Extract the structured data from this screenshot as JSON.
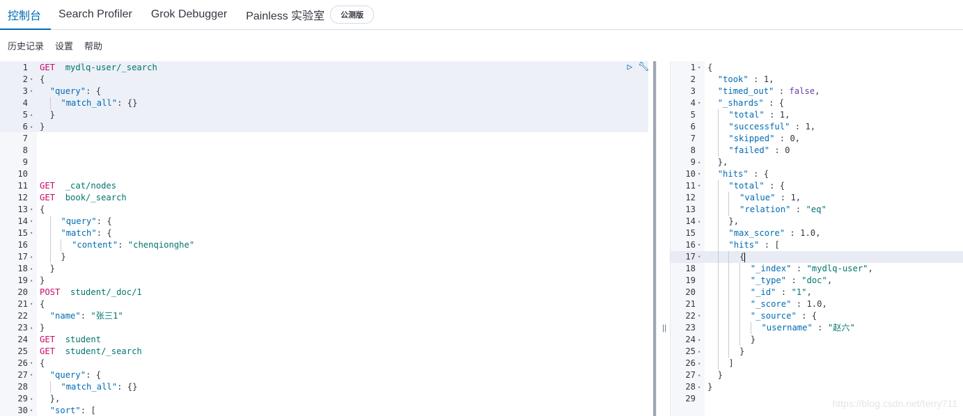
{
  "tabs": [
    {
      "label": "控制台",
      "active": true
    },
    {
      "label": "Search Profiler",
      "active": false
    },
    {
      "label": "Grok Debugger",
      "active": false
    },
    {
      "label": "Painless 实验室",
      "active": false,
      "badge": "公测版"
    }
  ],
  "menu": [
    "历史记录",
    "设置",
    "帮助"
  ],
  "actions": {
    "run_icon": "play-icon",
    "settings_icon": "wrench-icon"
  },
  "divider_handle": "||",
  "watermark": "https://blog.csdn.net/terry711",
  "request_lines": [
    {
      "n": "1",
      "fold": "",
      "segs": [
        [
          "kw",
          "GET"
        ],
        [
          "",
          "  "
        ],
        [
          "url",
          "mydlq-user/_search"
        ]
      ]
    },
    {
      "n": "2",
      "fold": "▾",
      "segs": [
        [
          "",
          "{"
        ]
      ]
    },
    {
      "n": "3",
      "fold": "▾",
      "segs": [
        [
          "",
          "  "
        ],
        [
          "key",
          "\"query\""
        ],
        [
          "",
          ": {"
        ]
      ]
    },
    {
      "n": "4",
      "fold": "",
      "segs": [
        [
          "",
          "  "
        ],
        [
          "g",
          ""
        ],
        [
          "",
          "  "
        ],
        [
          "key",
          "\"match_all\""
        ],
        [
          "",
          ": {}"
        ]
      ]
    },
    {
      "n": "5",
      "fold": "▴",
      "segs": [
        [
          "",
          "  }"
        ]
      ]
    },
    {
      "n": "6",
      "fold": "▴",
      "segs": [
        [
          "",
          "}"
        ]
      ]
    },
    {
      "n": "7",
      "fold": "",
      "segs": []
    },
    {
      "n": "8",
      "fold": "",
      "segs": []
    },
    {
      "n": "9",
      "fold": "",
      "segs": []
    },
    {
      "n": "10",
      "fold": "",
      "segs": []
    },
    {
      "n": "11",
      "fold": "",
      "segs": [
        [
          "kw",
          "GET"
        ],
        [
          "",
          "  "
        ],
        [
          "url",
          "_cat/nodes"
        ]
      ]
    },
    {
      "n": "12",
      "fold": "",
      "segs": [
        [
          "kw",
          "GET"
        ],
        [
          "",
          "  "
        ],
        [
          "url",
          "book/_search"
        ]
      ]
    },
    {
      "n": "13",
      "fold": "▾",
      "segs": [
        [
          "",
          "{"
        ]
      ]
    },
    {
      "n": "14",
      "fold": "▾",
      "segs": [
        [
          "",
          "  "
        ],
        [
          "g",
          ""
        ],
        [
          "",
          "  "
        ],
        [
          "key",
          "\"query\""
        ],
        [
          "",
          ": {"
        ]
      ]
    },
    {
      "n": "15",
      "fold": "▾",
      "segs": [
        [
          "",
          "  "
        ],
        [
          "g",
          ""
        ],
        [
          "",
          "  "
        ],
        [
          "key",
          "\"match\""
        ],
        [
          "",
          ": {"
        ]
      ]
    },
    {
      "n": "16",
      "fold": "",
      "segs": [
        [
          "",
          "  "
        ],
        [
          "g",
          ""
        ],
        [
          "",
          "  "
        ],
        [
          "g",
          ""
        ],
        [
          "",
          "  "
        ],
        [
          "key",
          "\"content\""
        ],
        [
          "",
          ": "
        ],
        [
          "str",
          "\"chenqionghe\""
        ]
      ]
    },
    {
      "n": "17",
      "fold": "▴",
      "segs": [
        [
          "",
          "  "
        ],
        [
          "g",
          ""
        ],
        [
          "",
          "  }"
        ]
      ]
    },
    {
      "n": "18",
      "fold": "▴",
      "segs": [
        [
          "",
          "  }"
        ]
      ]
    },
    {
      "n": "19",
      "fold": "▴",
      "segs": [
        [
          "",
          "}"
        ]
      ]
    },
    {
      "n": "20",
      "fold": "",
      "segs": [
        [
          "kw",
          "POST"
        ],
        [
          "",
          "  "
        ],
        [
          "url",
          "student/_doc/1"
        ]
      ]
    },
    {
      "n": "21",
      "fold": "▾",
      "segs": [
        [
          "",
          "{"
        ]
      ]
    },
    {
      "n": "22",
      "fold": "",
      "segs": [
        [
          "",
          "  "
        ],
        [
          "key",
          "\"name\""
        ],
        [
          "",
          ": "
        ],
        [
          "str",
          "\"张三1\""
        ]
      ]
    },
    {
      "n": "23",
      "fold": "▴",
      "segs": [
        [
          "",
          "}"
        ]
      ]
    },
    {
      "n": "24",
      "fold": "",
      "segs": [
        [
          "kw",
          "GET"
        ],
        [
          "",
          "  "
        ],
        [
          "url",
          "student"
        ]
      ]
    },
    {
      "n": "25",
      "fold": "",
      "segs": [
        [
          "kw",
          "GET"
        ],
        [
          "",
          "  "
        ],
        [
          "url",
          "student/_search"
        ]
      ]
    },
    {
      "n": "26",
      "fold": "▾",
      "segs": [
        [
          "",
          "{"
        ]
      ]
    },
    {
      "n": "27",
      "fold": "▾",
      "segs": [
        [
          "",
          "  "
        ],
        [
          "key",
          "\"query\""
        ],
        [
          "",
          ": {"
        ]
      ]
    },
    {
      "n": "28",
      "fold": "",
      "segs": [
        [
          "",
          "  "
        ],
        [
          "g",
          ""
        ],
        [
          "",
          "  "
        ],
        [
          "key",
          "\"match_all\""
        ],
        [
          "",
          ": {}"
        ]
      ]
    },
    {
      "n": "29",
      "fold": "▴",
      "segs": [
        [
          "",
          "  },"
        ]
      ]
    },
    {
      "n": "30",
      "fold": "▾",
      "segs": [
        [
          "",
          "  "
        ],
        [
          "key",
          "\"sort\""
        ],
        [
          "",
          ": ["
        ]
      ]
    }
  ],
  "response_lines": [
    {
      "n": "1",
      "fold": "▾",
      "segs": [
        [
          "",
          "{"
        ]
      ]
    },
    {
      "n": "2",
      "fold": "",
      "segs": [
        [
          "",
          "  "
        ],
        [
          "key",
          "\"took\""
        ],
        [
          "",
          " : "
        ],
        [
          "num",
          "1"
        ],
        [
          "",
          ","
        ]
      ]
    },
    {
      "n": "3",
      "fold": "",
      "segs": [
        [
          "",
          "  "
        ],
        [
          "key",
          "\"timed_out\""
        ],
        [
          "",
          " : "
        ],
        [
          "bool",
          "false"
        ],
        [
          "",
          ","
        ]
      ]
    },
    {
      "n": "4",
      "fold": "▾",
      "segs": [
        [
          "",
          "  "
        ],
        [
          "key",
          "\"_shards\""
        ],
        [
          "",
          " : {"
        ]
      ]
    },
    {
      "n": "5",
      "fold": "",
      "segs": [
        [
          "",
          "  "
        ],
        [
          "g",
          ""
        ],
        [
          "",
          "  "
        ],
        [
          "key",
          "\"total\""
        ],
        [
          "",
          " : "
        ],
        [
          "num",
          "1"
        ],
        [
          "",
          ","
        ]
      ]
    },
    {
      "n": "6",
      "fold": "",
      "segs": [
        [
          "",
          "  "
        ],
        [
          "g",
          ""
        ],
        [
          "",
          "  "
        ],
        [
          "key",
          "\"successful\""
        ],
        [
          "",
          " : "
        ],
        [
          "num",
          "1"
        ],
        [
          "",
          ","
        ]
      ]
    },
    {
      "n": "7",
      "fold": "",
      "segs": [
        [
          "",
          "  "
        ],
        [
          "g",
          ""
        ],
        [
          "",
          "  "
        ],
        [
          "key",
          "\"skipped\""
        ],
        [
          "",
          " : "
        ],
        [
          "num",
          "0"
        ],
        [
          "",
          ","
        ]
      ]
    },
    {
      "n": "8",
      "fold": "",
      "segs": [
        [
          "",
          "  "
        ],
        [
          "g",
          ""
        ],
        [
          "",
          "  "
        ],
        [
          "key",
          "\"failed\""
        ],
        [
          "",
          " : "
        ],
        [
          "num",
          "0"
        ]
      ]
    },
    {
      "n": "9",
      "fold": "▴",
      "segs": [
        [
          "",
          "  },"
        ]
      ]
    },
    {
      "n": "10",
      "fold": "▾",
      "segs": [
        [
          "",
          "  "
        ],
        [
          "key",
          "\"hits\""
        ],
        [
          "",
          " : {"
        ]
      ]
    },
    {
      "n": "11",
      "fold": "▾",
      "segs": [
        [
          "",
          "  "
        ],
        [
          "g",
          ""
        ],
        [
          "",
          "  "
        ],
        [
          "key",
          "\"total\""
        ],
        [
          "",
          " : {"
        ]
      ]
    },
    {
      "n": "12",
      "fold": "",
      "segs": [
        [
          "",
          "  "
        ],
        [
          "g",
          ""
        ],
        [
          "",
          "  "
        ],
        [
          "g",
          ""
        ],
        [
          "",
          "  "
        ],
        [
          "key",
          "\"value\""
        ],
        [
          "",
          " : "
        ],
        [
          "num",
          "1"
        ],
        [
          "",
          ","
        ]
      ]
    },
    {
      "n": "13",
      "fold": "",
      "segs": [
        [
          "",
          "  "
        ],
        [
          "g",
          ""
        ],
        [
          "",
          "  "
        ],
        [
          "g",
          ""
        ],
        [
          "",
          "  "
        ],
        [
          "key",
          "\"relation\""
        ],
        [
          "",
          " : "
        ],
        [
          "str",
          "\"eq\""
        ]
      ]
    },
    {
      "n": "14",
      "fold": "▴",
      "segs": [
        [
          "",
          "  "
        ],
        [
          "g",
          ""
        ],
        [
          "",
          "  },"
        ]
      ]
    },
    {
      "n": "15",
      "fold": "",
      "segs": [
        [
          "",
          "  "
        ],
        [
          "g",
          ""
        ],
        [
          "",
          "  "
        ],
        [
          "key",
          "\"max_score\""
        ],
        [
          "",
          " : "
        ],
        [
          "num",
          "1.0"
        ],
        [
          "",
          ","
        ]
      ]
    },
    {
      "n": "16",
      "fold": "▾",
      "segs": [
        [
          "",
          "  "
        ],
        [
          "g",
          ""
        ],
        [
          "",
          "  "
        ],
        [
          "key",
          "\"hits\""
        ],
        [
          "",
          " : ["
        ]
      ]
    },
    {
      "n": "17",
      "fold": "▾",
      "segs": [
        [
          "",
          "  "
        ],
        [
          "g",
          ""
        ],
        [
          "",
          "  "
        ],
        [
          "g",
          ""
        ],
        [
          "",
          "  {"
        ],
        [
          "caret",
          ""
        ]
      ]
    },
    {
      "n": "18",
      "fold": "",
      "segs": [
        [
          "",
          "  "
        ],
        [
          "g",
          ""
        ],
        [
          "",
          "  "
        ],
        [
          "g",
          ""
        ],
        [
          "",
          "  "
        ],
        [
          "g",
          ""
        ],
        [
          "",
          "  "
        ],
        [
          "key",
          "\"_index\""
        ],
        [
          "",
          " : "
        ],
        [
          "str",
          "\"mydlq-user\""
        ],
        [
          "",
          ","
        ]
      ]
    },
    {
      "n": "19",
      "fold": "",
      "segs": [
        [
          "",
          "  "
        ],
        [
          "g",
          ""
        ],
        [
          "",
          "  "
        ],
        [
          "g",
          ""
        ],
        [
          "",
          "  "
        ],
        [
          "g",
          ""
        ],
        [
          "",
          "  "
        ],
        [
          "key",
          "\"_type\""
        ],
        [
          "",
          " : "
        ],
        [
          "str",
          "\"doc\""
        ],
        [
          "",
          ","
        ]
      ]
    },
    {
      "n": "20",
      "fold": "",
      "segs": [
        [
          "",
          "  "
        ],
        [
          "g",
          ""
        ],
        [
          "",
          "  "
        ],
        [
          "g",
          ""
        ],
        [
          "",
          "  "
        ],
        [
          "g",
          ""
        ],
        [
          "",
          "  "
        ],
        [
          "key",
          "\"_id\""
        ],
        [
          "",
          " : "
        ],
        [
          "str",
          "\"1\""
        ],
        [
          "",
          ","
        ]
      ]
    },
    {
      "n": "21",
      "fold": "",
      "segs": [
        [
          "",
          "  "
        ],
        [
          "g",
          ""
        ],
        [
          "",
          "  "
        ],
        [
          "g",
          ""
        ],
        [
          "",
          "  "
        ],
        [
          "g",
          ""
        ],
        [
          "",
          "  "
        ],
        [
          "key",
          "\"_score\""
        ],
        [
          "",
          " : "
        ],
        [
          "num",
          "1.0"
        ],
        [
          "",
          ","
        ]
      ]
    },
    {
      "n": "22",
      "fold": "▾",
      "segs": [
        [
          "",
          "  "
        ],
        [
          "g",
          ""
        ],
        [
          "",
          "  "
        ],
        [
          "g",
          ""
        ],
        [
          "",
          "  "
        ],
        [
          "g",
          ""
        ],
        [
          "",
          "  "
        ],
        [
          "key",
          "\"_source\""
        ],
        [
          "",
          " : {"
        ]
      ]
    },
    {
      "n": "23",
      "fold": "",
      "segs": [
        [
          "",
          "  "
        ],
        [
          "g",
          ""
        ],
        [
          "",
          "  "
        ],
        [
          "g",
          ""
        ],
        [
          "",
          "  "
        ],
        [
          "g",
          ""
        ],
        [
          "",
          "  "
        ],
        [
          "g",
          ""
        ],
        [
          "",
          "  "
        ],
        [
          "key",
          "\"username\""
        ],
        [
          "",
          " : "
        ],
        [
          "str",
          "\"赵六\""
        ]
      ]
    },
    {
      "n": "24",
      "fold": "▴",
      "segs": [
        [
          "",
          "  "
        ],
        [
          "g",
          ""
        ],
        [
          "",
          "  "
        ],
        [
          "g",
          ""
        ],
        [
          "",
          "  "
        ],
        [
          "g",
          ""
        ],
        [
          "",
          "  }"
        ]
      ]
    },
    {
      "n": "25",
      "fold": "▴",
      "segs": [
        [
          "",
          "  "
        ],
        [
          "g",
          ""
        ],
        [
          "",
          "  "
        ],
        [
          "g",
          ""
        ],
        [
          "",
          "  }"
        ]
      ]
    },
    {
      "n": "26",
      "fold": "▴",
      "segs": [
        [
          "",
          "  "
        ],
        [
          "g",
          ""
        ],
        [
          "",
          "  ]"
        ]
      ]
    },
    {
      "n": "27",
      "fold": "▴",
      "segs": [
        [
          "",
          "  }"
        ]
      ]
    },
    {
      "n": "28",
      "fold": "▴",
      "segs": [
        [
          "",
          "}"
        ]
      ]
    },
    {
      "n": "29",
      "fold": "",
      "segs": []
    }
  ]
}
